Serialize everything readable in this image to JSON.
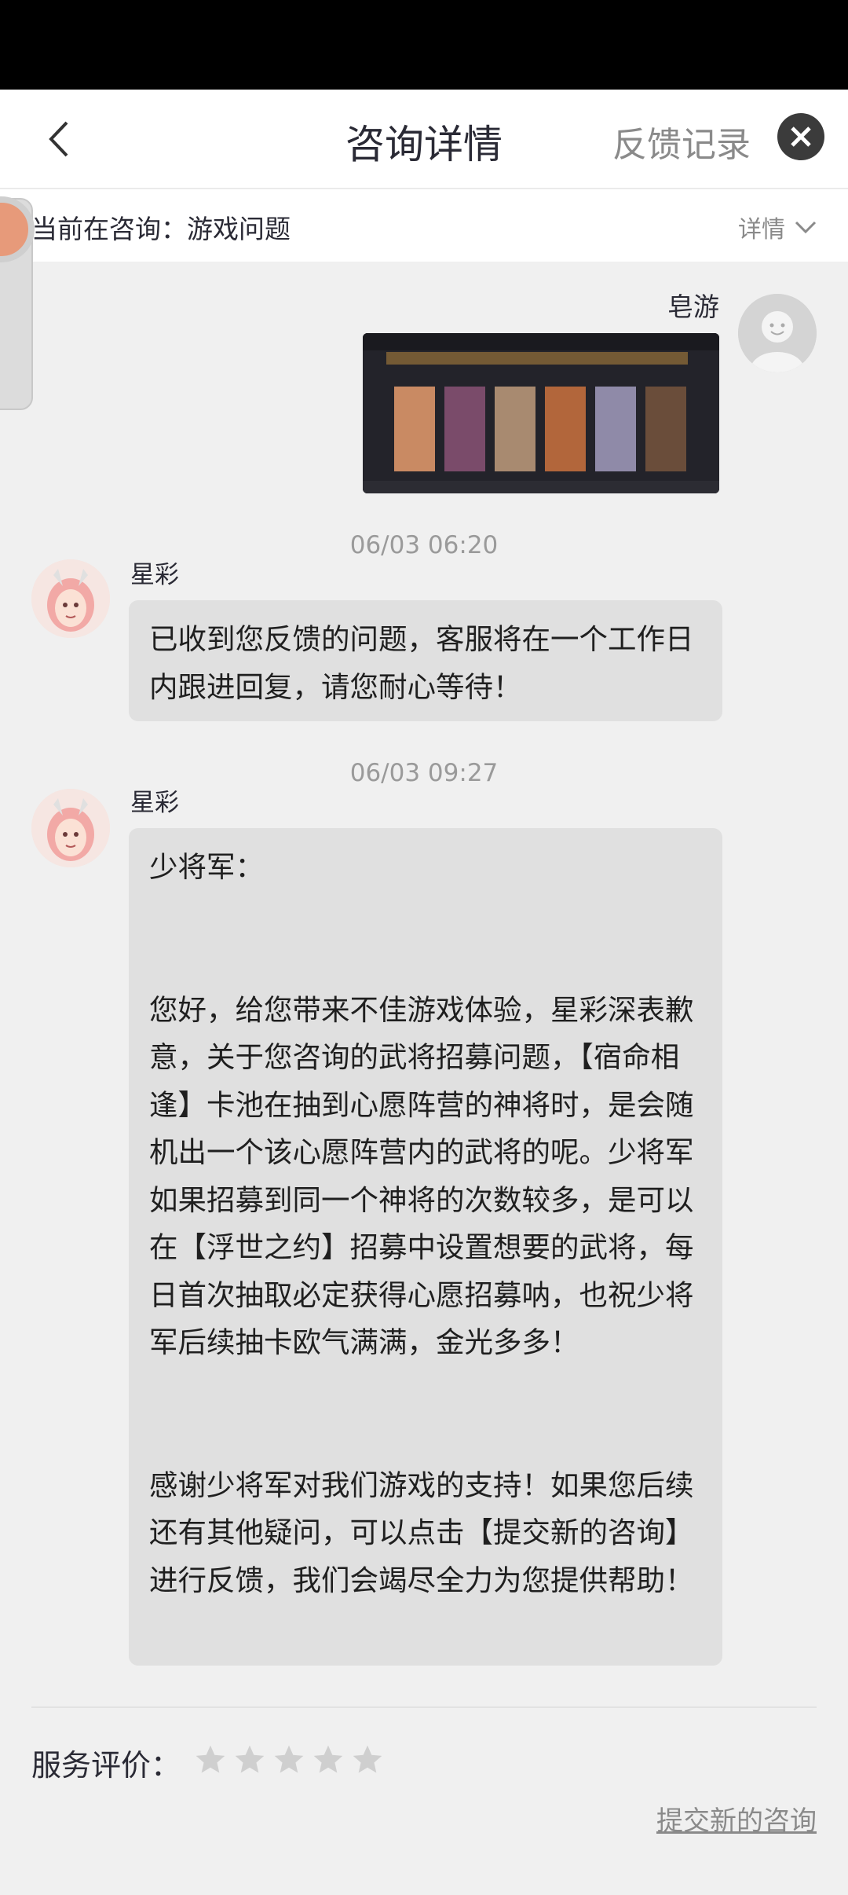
{
  "header": {
    "title": "咨询详情",
    "feedback_link": "反馈记录"
  },
  "topic": {
    "text": "当前在咨询：游戏问题",
    "detail_label": "详情"
  },
  "user": {
    "name": "皂游"
  },
  "messages": [
    {
      "timestamp": "06/03 06:20",
      "sender": "星彩",
      "text": "已收到您反馈的问题，客服将在一个工作日内跟进回复，请您耐心等待！"
    },
    {
      "timestamp": "06/03 09:27",
      "sender": "星彩",
      "text": "少将军：\n\n\n您好，给您带来不佳游戏体验，星彩深表歉意，关于您咨询的武将招募问题，【宿命相逢】卡池在抽到心愿阵营的神将时，是会随机出一个该心愿阵营内的武将的呢。少将军如果招募到同一个神将的次数较多，是可以在【浮世之约】招募中设置想要的武将，每日首次抽取必定获得心愿招募呐，也祝少将军后续抽卡欧气满满，金光多多！\n\n\n感谢少将军对我们游戏的支持！如果您后续还有其他疑问，可以点击【提交新的咨询】进行反馈，我们会竭尽全力为您提供帮助！"
    }
  ],
  "rating": {
    "label": "服务评价：",
    "stars_total": 5,
    "stars_selected": 0
  },
  "footer": {
    "new_consult": "提交新的咨询"
  },
  "icons": {
    "back": "chevron-left-icon",
    "close": "close-icon",
    "detail": "chevron-down-icon",
    "star": "star-icon"
  },
  "colors": {
    "bubble": "#e0e0e0",
    "background": "#f0f0f0",
    "star_empty": "#cfcfcf"
  }
}
